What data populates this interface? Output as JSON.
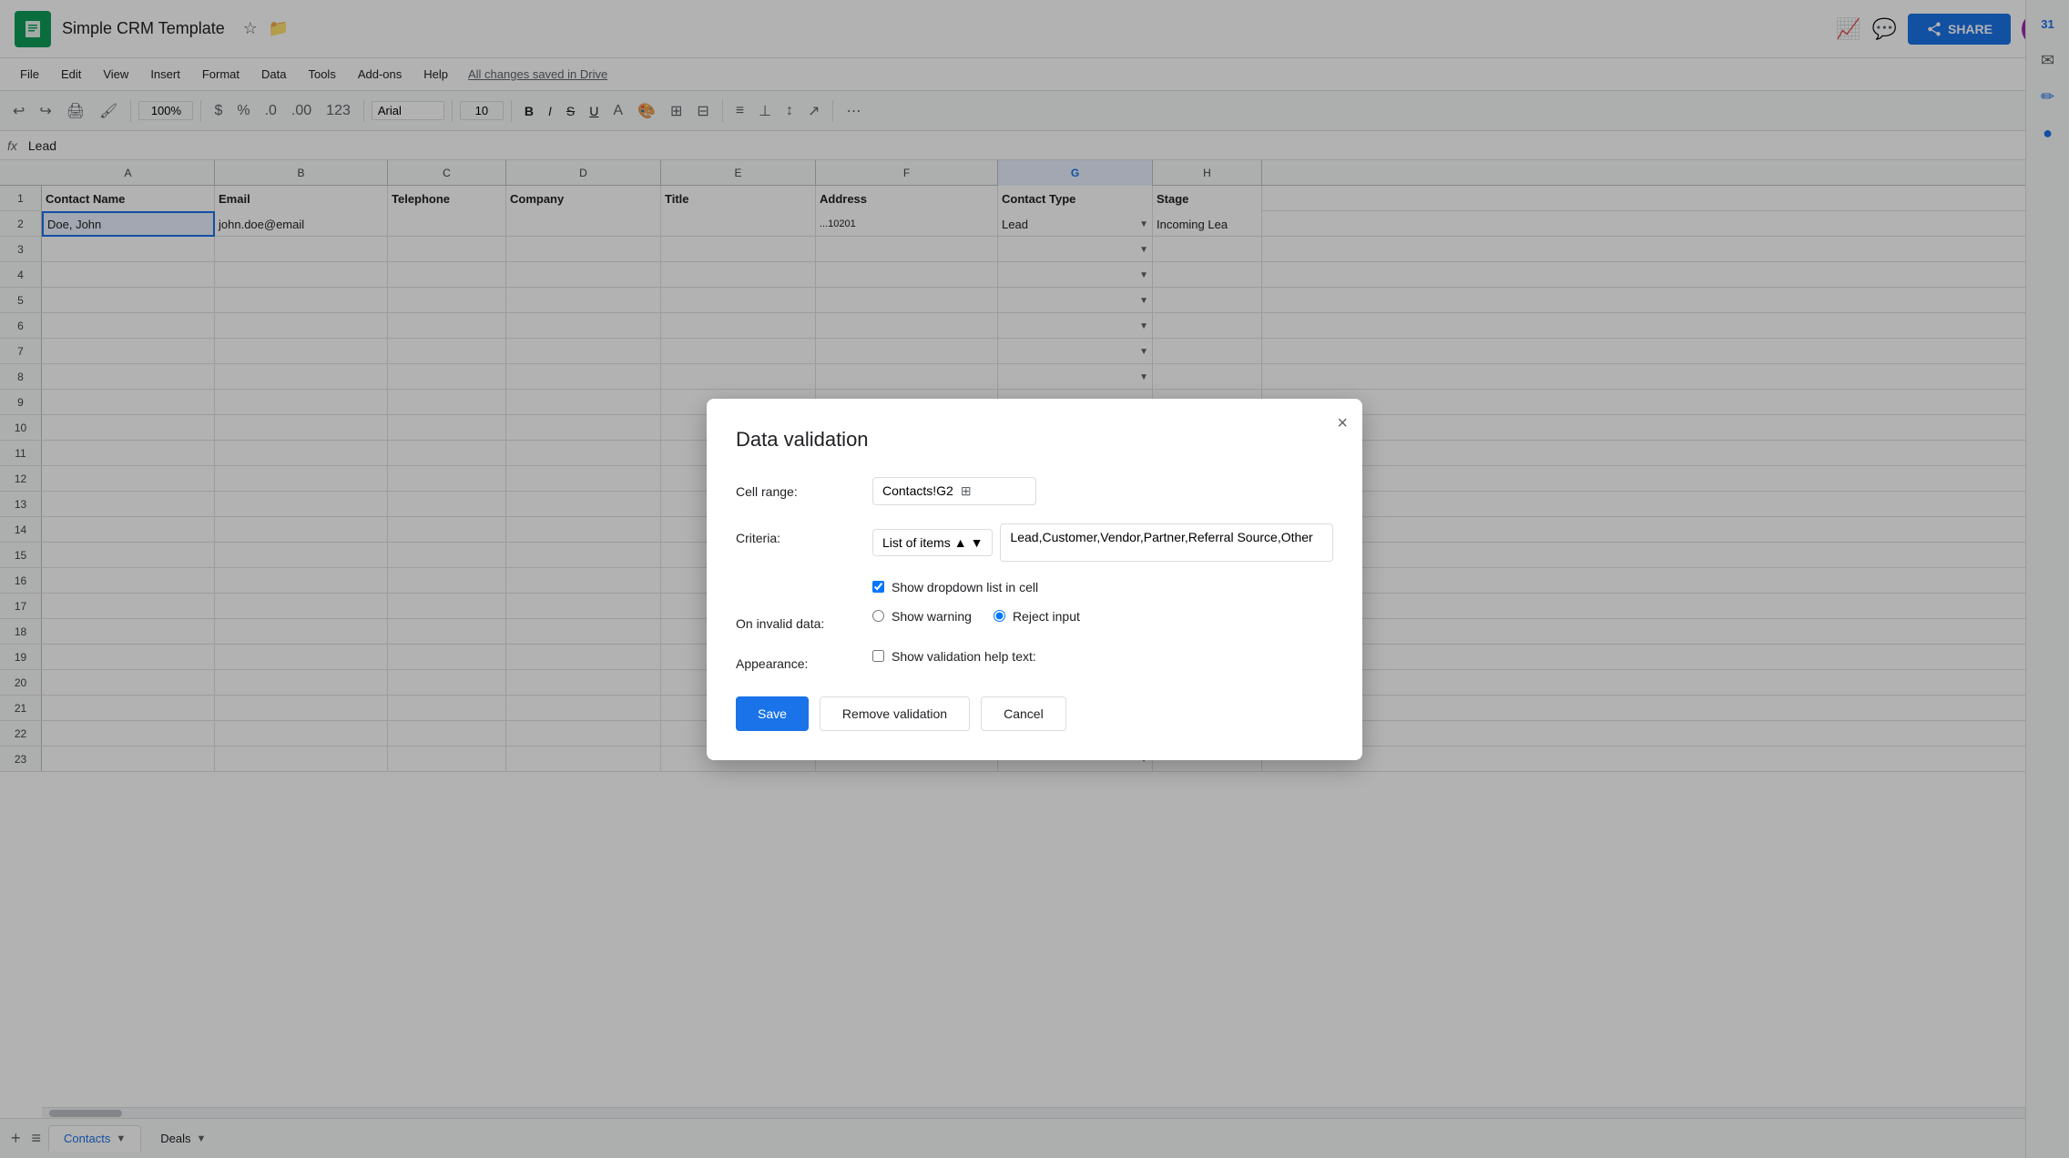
{
  "app": {
    "icon": "≡",
    "title": "Simple CRM Template",
    "saved_status": "All changes saved in Drive"
  },
  "menu": {
    "items": [
      "File",
      "Edit",
      "View",
      "Insert",
      "Format",
      "Data",
      "Tools",
      "Add-ons",
      "Help"
    ]
  },
  "toolbar": {
    "zoom": "100%",
    "font": "Arial",
    "font_size": "10",
    "bold": "B",
    "italic": "I",
    "strikethrough": "S",
    "underline": "U"
  },
  "formula_bar": {
    "fx": "fx",
    "cell_ref": "Lead"
  },
  "columns": {
    "letters": [
      "A",
      "B",
      "C",
      "D",
      "E",
      "F",
      "G",
      "H"
    ],
    "headers": [
      "Contact Name",
      "Email",
      "Telephone",
      "Company",
      "Title",
      "Address",
      "Contact Type",
      "Stage"
    ]
  },
  "row2": {
    "contact_name": "Doe, John",
    "email": "john.doe@email",
    "contact_type": "Lead",
    "stage": "Incoming Lea"
  },
  "modal": {
    "title": "Data validation",
    "close_label": "×",
    "cell_range_label": "Cell range:",
    "cell_range_value": "Contacts!G2",
    "criteria_label": "Criteria:",
    "criteria_type": "List of items",
    "criteria_value": "Lead,Customer,Vendor,Partner,Referral Source,Other",
    "show_dropdown_label": "Show dropdown list in cell",
    "show_dropdown_checked": true,
    "on_invalid_label": "On invalid data:",
    "show_warning_label": "Show warning",
    "reject_input_label": "Reject input",
    "reject_selected": true,
    "appearance_label": "Appearance:",
    "help_text_label": "Show validation help text:",
    "help_text_checked": false,
    "save_label": "Save",
    "remove_label": "Remove validation",
    "cancel_label": "Cancel"
  },
  "sheet_tabs": {
    "active": "Contacts",
    "inactive": "Deals"
  },
  "right_panel": {
    "icons": [
      "31",
      "☆",
      "✎",
      "🔵"
    ]
  }
}
